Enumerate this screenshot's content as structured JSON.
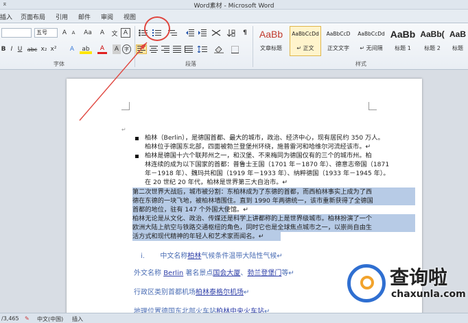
{
  "window": {
    "title": "Word素材 - Microsoft Word",
    "qat_glyph": "⌅"
  },
  "tabs": [
    "插入",
    "页面布局",
    "引用",
    "邮件",
    "审阅",
    "视图"
  ],
  "ribbon": {
    "font": {
      "font_size": "五号",
      "grow_label": "A",
      "shrink_label": "A",
      "case_label": "Aa",
      "clear_format_label": "A",
      "phonetic_label": "文",
      "border_char_label": "A",
      "bold": "B",
      "italic": "I",
      "underline": "U",
      "strike": "abc",
      "subscript": "x₂",
      "superscript": "x²",
      "text_effect": "A",
      "highlight": "ab",
      "font_color": "A",
      "char_shade": "A",
      "enclose": "字",
      "group_label": "字体"
    },
    "paragraph": {
      "group_label": "段落"
    },
    "styles": {
      "group_label": "样式",
      "items": [
        {
          "sample": "AaBb",
          "name": "文章标题"
        },
        {
          "sample": "AaBbCcDd",
          "name": "↵ 正文"
        },
        {
          "sample": "AaBbCcD",
          "name": "正文文字"
        },
        {
          "sample": "AaBbCcDd",
          "name": "↵ 无间隔"
        },
        {
          "sample": "AaBb",
          "name": "标题 1"
        },
        {
          "sample": "AaBb(",
          "name": "标题 2"
        },
        {
          "sample": "AaB",
          "name": "标题"
        }
      ]
    }
  },
  "document": {
    "bullet_lines": [
      "柏林（Berlin），是德国首都、最大的城市，政治、经济中心，现有居民约 350 万人。",
      "柏林位于德国东北部，四面被勃兰登堡州环绕，施普雷河和哈维尔河流经该市。↵",
      "柏林是德国十六个联邦州之一，和汉堡、不来梅同为德国仅有的三个的城市州。柏",
      "林连续的成为以下国家的首都：普鲁士王国（1701 年－1870 年）、德意志帝国（1871",
      "年－1918 年）、魏玛共和国（1919 年－1933 年）、纳粹德国（1933 年－1945 年）。",
      "在 20 世纪 20 年代，柏林是世界第三大自治市。↵"
    ],
    "selected_lines": [
      "第二次世界大战后，城市被分割：东柏林成为了东德的首都，而西柏林事实上成为了西",
      "德在东德的一块飞地，被柏林墙围住。直到 1990 年两德统一，该市重新获得了全德国",
      "首都的地位，驻有 147 个外国大使馆。↵",
      "柏林无论是从文化、政治、传媒还是科学上讲都称的上是世界级城市。柏林扮演了一个",
      "欧洲大陆上航空与铁路交通枢纽的角色，同时它也是全球焦点城市之一，以崇尚自由生",
      "活方式和现代精神的年轻人和艺术家而闻名。↵"
    ],
    "numbered": {
      "marker": "i.",
      "text_a": "中文名称",
      "link_a": "柏林",
      "text_b": "气候条件温带大陆性气候↵"
    },
    "line2": {
      "text_a": "外文名称 ",
      "link_a": "Berlin",
      "text_b": " 著名景点",
      "link_b": "国会大厦",
      "text_c": "、",
      "link_c": "勃兰登堡门",
      "text_d": "等↵"
    },
    "line3": {
      "text_a": "行政区类别首都机场",
      "link_a": "柏林泰格尔机场",
      "text_b": "↵"
    },
    "line4": {
      "text_a": "地理位置德国东北部火车站",
      "link_a": "柏林中央火车站",
      "text_b": "↵"
    },
    "top_para_mark": "↵"
  },
  "statusbar": {
    "words": "/3,465",
    "language": "中文(中国)",
    "mode": "插入"
  },
  "watermark": {
    "cn": "查询啦",
    "en": "chaxunla.com"
  },
  "colors": {
    "selection": "#b7cbe6",
    "annotation": "#e0463f",
    "link": "#4b6eb5"
  }
}
